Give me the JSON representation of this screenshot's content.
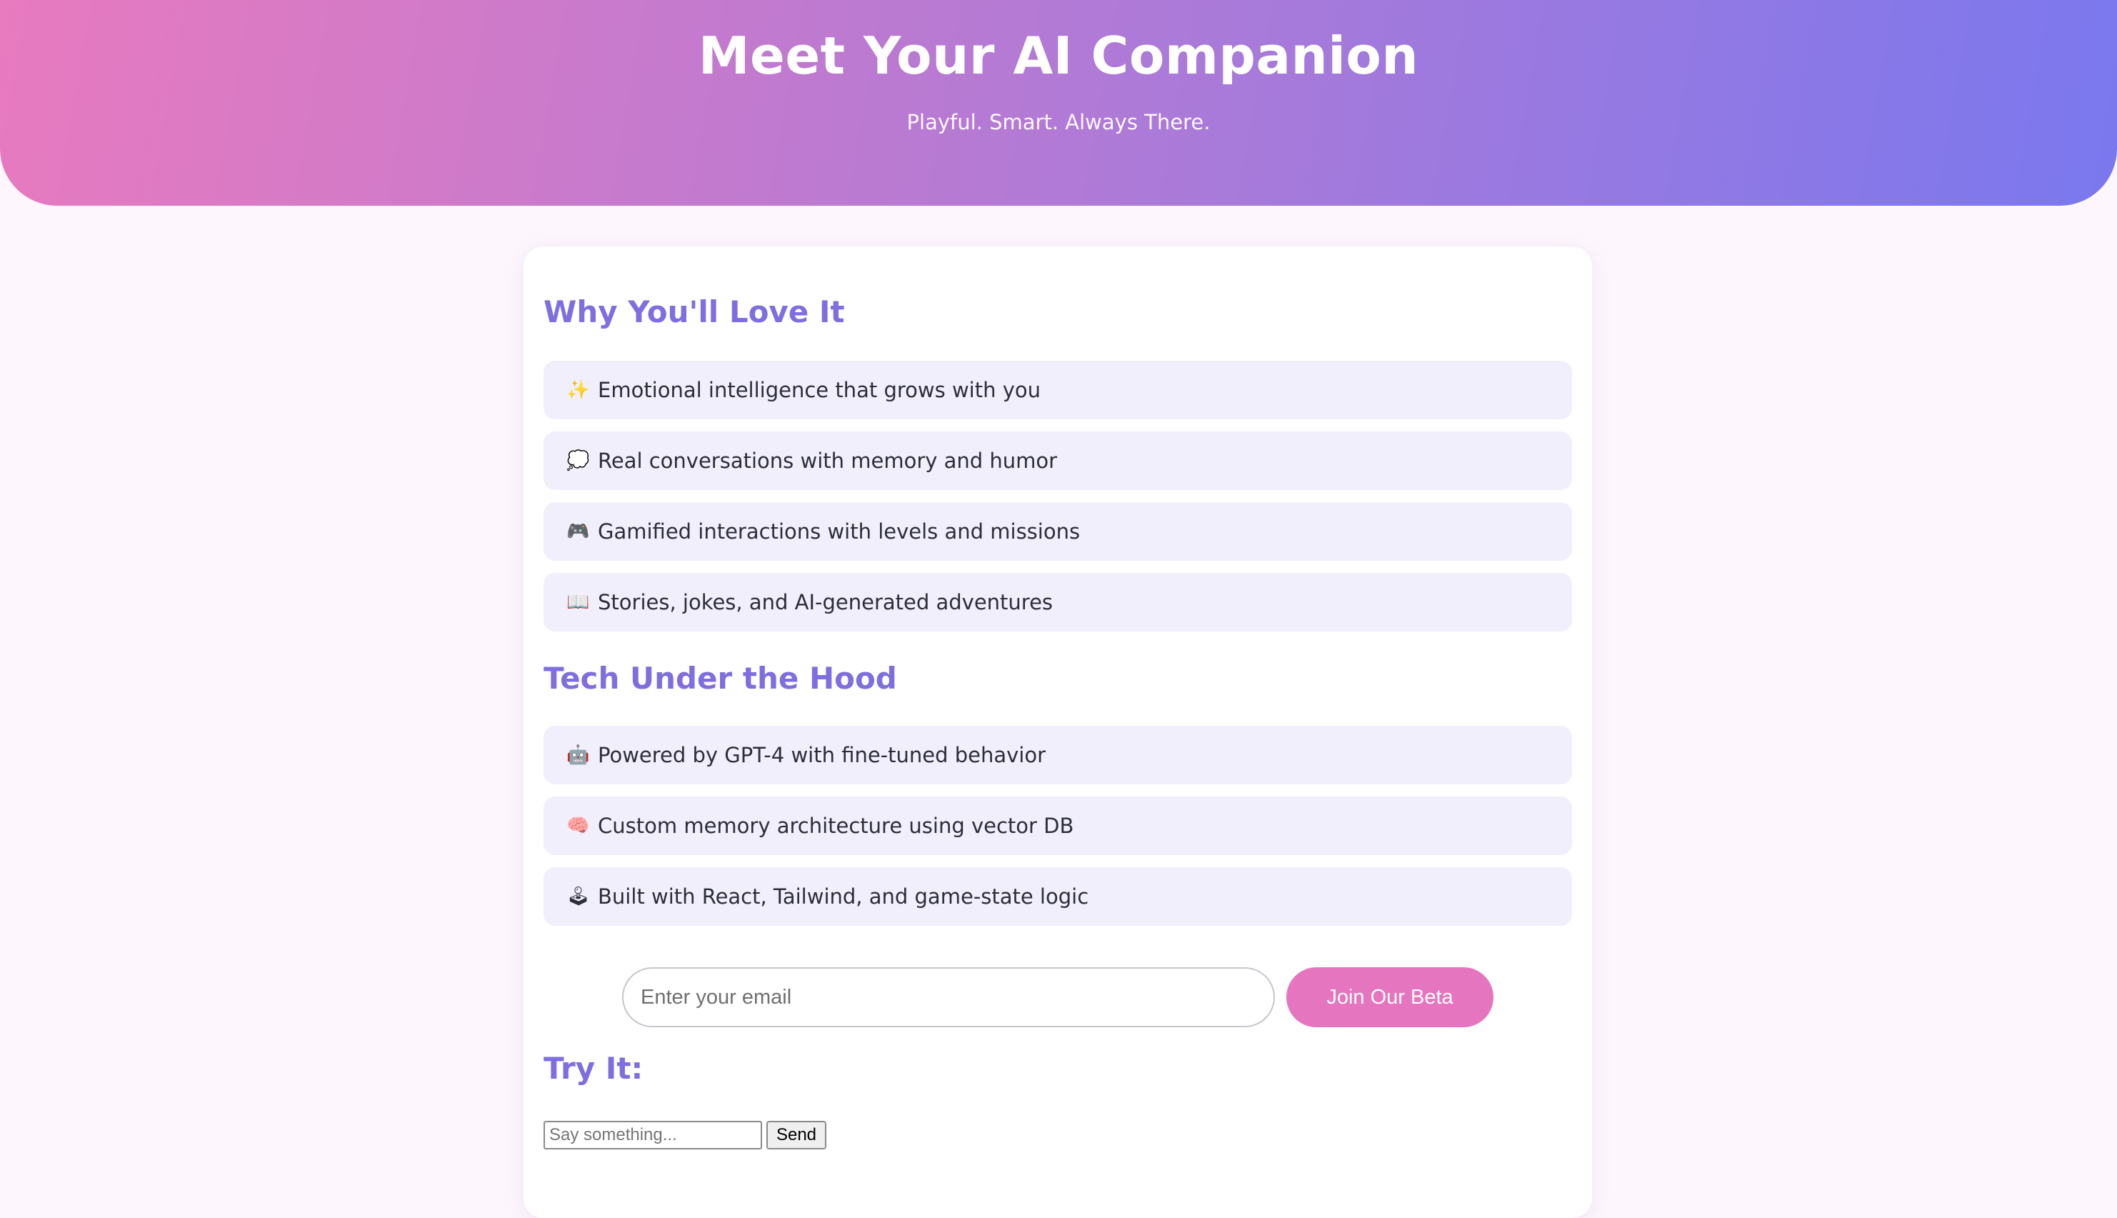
{
  "hero": {
    "title": "Meet Your AI Companion",
    "subtitle": "Playful. Smart. Always There."
  },
  "features": {
    "title": "Why You'll Love It",
    "items": [
      {
        "icon": "sparkles-icon",
        "glyph": "✨",
        "text": "Emotional intelligence that grows with you"
      },
      {
        "icon": "speech-bubble-icon",
        "glyph": "💭",
        "text": "Real conversations with memory and humor"
      },
      {
        "icon": "game-controller-icon",
        "glyph": "🎮",
        "text": "Gamified interactions with levels and missions"
      },
      {
        "icon": "open-book-icon",
        "glyph": "📖",
        "text": "Stories, jokes, and AI-generated adventures"
      }
    ]
  },
  "tech": {
    "title": "Tech Under the Hood",
    "items": [
      {
        "icon": "robot-icon",
        "glyph": "🤖",
        "text": "Powered by GPT-4 with fine-tuned behavior"
      },
      {
        "icon": "brain-icon",
        "glyph": "🧠",
        "text": "Custom memory architecture using vector DB"
      },
      {
        "icon": "joystick-icon",
        "glyph": "🕹",
        "text": "Built with React, Tailwind, and game-state logic"
      }
    ]
  },
  "signup": {
    "email_placeholder": "Enter your email",
    "button_label": "Join Our Beta"
  },
  "try_it": {
    "title": "Try It:",
    "input_placeholder": "Say something...",
    "send_label": "Send"
  },
  "colors": {
    "gradient_start": "#e87abf",
    "gradient_end": "#7a78ee",
    "heading": "#7f6ee0",
    "item_background": "#f1effc",
    "button": "#e575bf"
  }
}
